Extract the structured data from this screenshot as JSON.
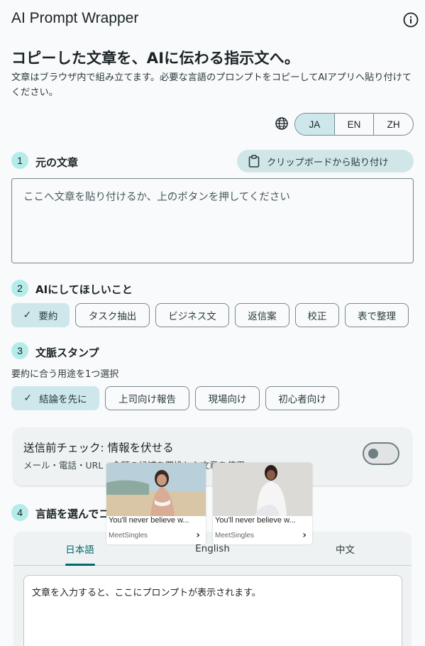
{
  "app": {
    "title": "AI Prompt Wrapper"
  },
  "hero": {
    "headline": "コピーした文章を、AIに伝わる指示文へ。",
    "description": "文章はブラウザ内で組み立てます。必要な言語のプロンプトをコピーしてAIアプリへ貼り付けてください。"
  },
  "language_toggle": {
    "options": [
      "JA",
      "EN",
      "ZH"
    ],
    "selected": "JA"
  },
  "step1": {
    "number": "1",
    "label": "元の文章",
    "paste_button": "クリップボードから貼り付け",
    "placeholder": "ここへ文章を貼り付けるか、上のボタンを押してください"
  },
  "step2": {
    "number": "2",
    "label": "AIにしてほしいこと",
    "chips": [
      "要約",
      "タスク抽出",
      "ビジネス文",
      "返信案",
      "校正",
      "表で整理"
    ],
    "selected": "要約"
  },
  "step3": {
    "number": "3",
    "label": "文脈スタンプ",
    "sublabel": "要約に合う用途を1つ選択",
    "chips": [
      "結論を先に",
      "上司向け報告",
      "現場向け",
      "初心者向け"
    ],
    "selected": "結論を先に"
  },
  "privacy_card": {
    "title": "送信前チェック: 情報を伏せる",
    "subtitle": "メール・電話・URL・金額の候補を置換した文章を使用",
    "toggle_on": false
  },
  "step4": {
    "number": "4",
    "label": "言語を選んでコピー",
    "tabs": [
      "日本語",
      "English",
      "中文"
    ],
    "active_tab": "日本語",
    "output_placeholder": "文章を入力すると、ここにプロンプトが表示されます。"
  },
  "ads": [
    {
      "title": "You'll never believe w...",
      "source": "MeetSingles"
    },
    {
      "title": "You'll never believe w...",
      "source": "MeetSingles"
    }
  ],
  "colors": {
    "accent": "#00696d",
    "chip_selected": "#cde7ea",
    "step_badge": "#b4ece9"
  }
}
